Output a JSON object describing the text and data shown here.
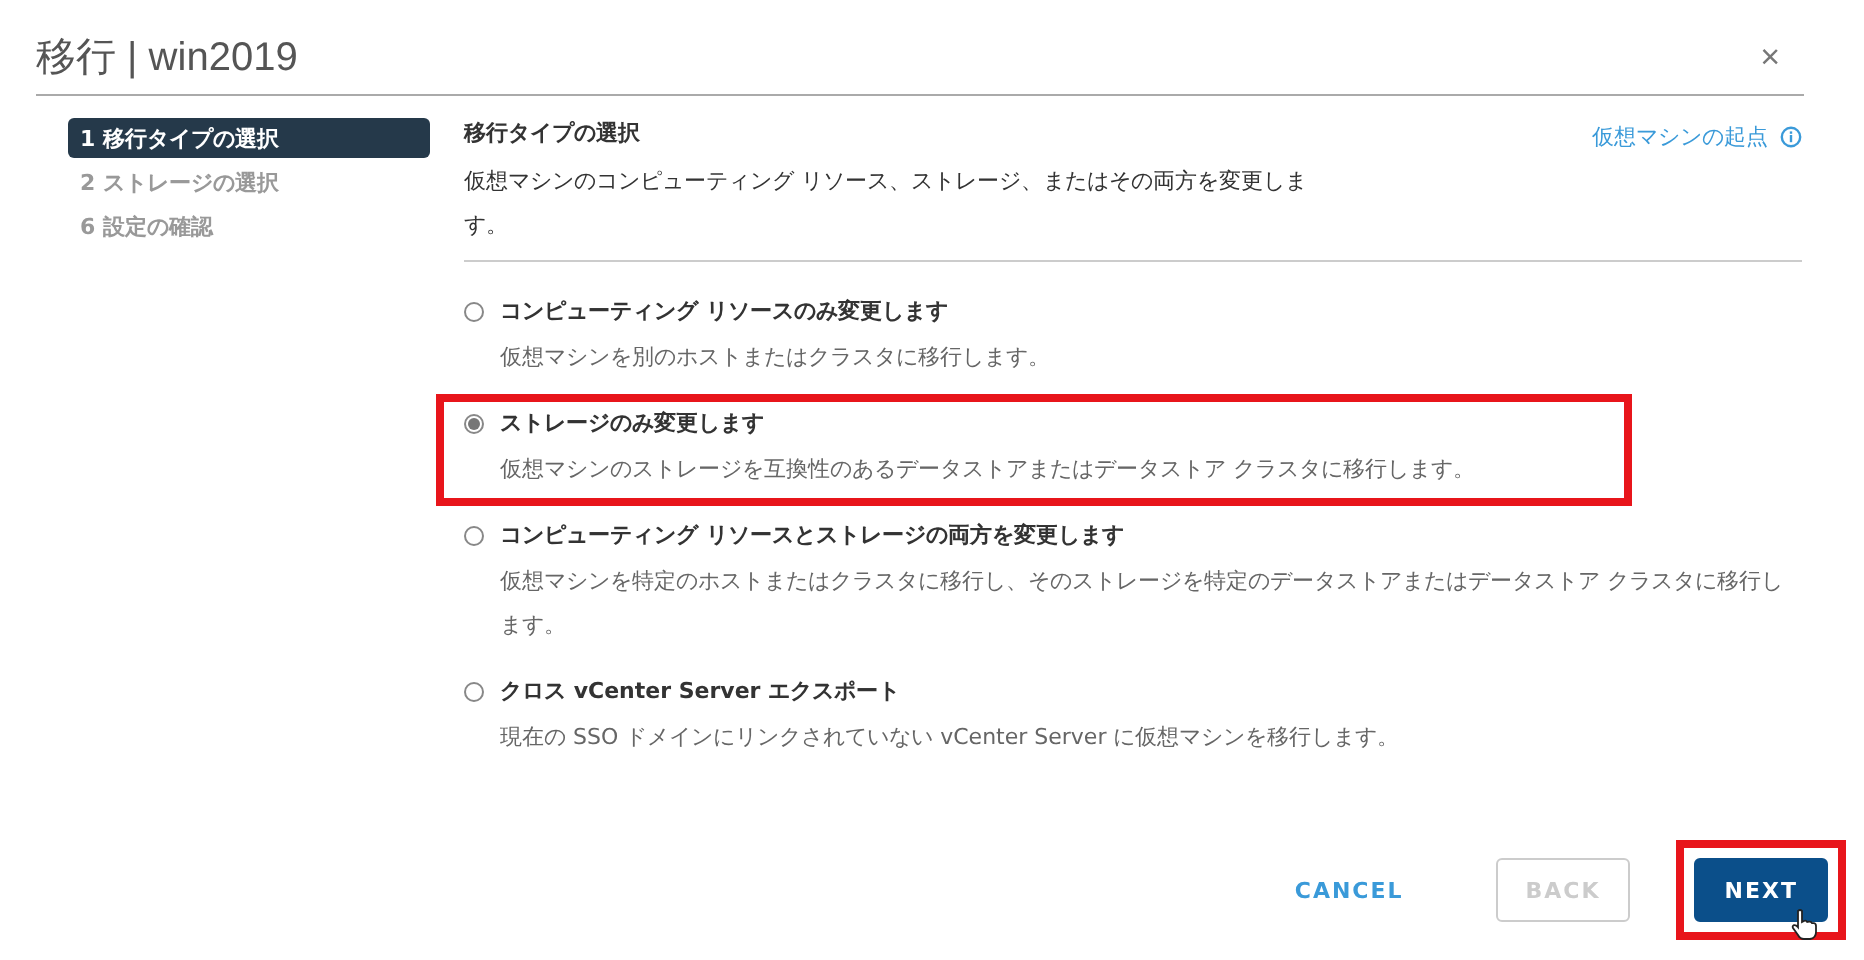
{
  "window": {
    "title": "移行 | win2019",
    "close": "×"
  },
  "steps": [
    {
      "label": "1 移行タイプの選択",
      "selected": true
    },
    {
      "label": "2 ストレージの選択",
      "selected": false
    },
    {
      "label": "6 設定の確認",
      "selected": false
    }
  ],
  "section": {
    "title": "移行タイプの選択",
    "description": "仮想マシンのコンピューティング リソース、ストレージ、またはその両方を変更します。",
    "link": "仮想マシンの起点"
  },
  "options": [
    {
      "title": "コンピューティング リソースのみ変更します",
      "description": "仮想マシンを別のホストまたはクラスタに移行します。",
      "selected": false,
      "highlighted": false
    },
    {
      "title": "ストレージのみ変更します",
      "description": "仮想マシンのストレージを互換性のあるデータストアまたはデータストア クラスタに移行します。",
      "selected": true,
      "highlighted": true
    },
    {
      "title": "コンピューティング リソースとストレージの両方を変更します",
      "description": "仮想マシンを特定のホストまたはクラスタに移行し、そのストレージを特定のデータストアまたはデータストア クラスタに移行します。",
      "selected": false,
      "highlighted": false
    },
    {
      "title": "クロス vCenter Server エクスポート",
      "description": "現在の SSO ドメインにリンクされていない vCenter Server に仮想マシンを移行します。",
      "selected": false,
      "highlighted": false
    }
  ],
  "buttons": [
    {
      "label": "CANCEL",
      "kind": "link",
      "disabled": false,
      "highlighted": false
    },
    {
      "label": "BACK",
      "kind": "outline",
      "disabled": true,
      "highlighted": false
    },
    {
      "label": "NEXT",
      "kind": "primary",
      "disabled": false,
      "highlighted": true
    }
  ]
}
